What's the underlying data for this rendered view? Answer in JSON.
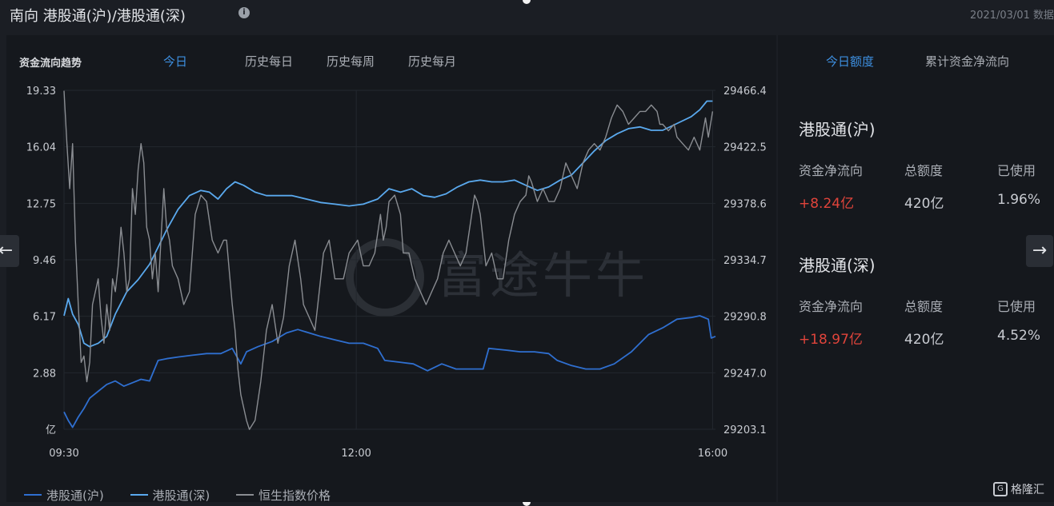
{
  "header": {
    "title": "南向 港股通(沪)/港股通(深)",
    "date": "2021/03/01 数据"
  },
  "chart_tabs": {
    "label": "资金流向趋势",
    "items": [
      "今日",
      "历史每日",
      "历史每周",
      "历史每月"
    ],
    "active": "今日"
  },
  "right_tabs": {
    "items": [
      "今日额度",
      "累计资金净流向"
    ],
    "active": "今日额度"
  },
  "quota": [
    {
      "title": "港股通(沪)",
      "headers": [
        "资金净流向",
        "总额度",
        "已使用"
      ],
      "values": [
        "+8.24亿",
        "420亿",
        "1.96%"
      ]
    },
    {
      "title": "港股通(深)",
      "headers": [
        "资金净流向",
        "总额度",
        "已使用"
      ],
      "values": [
        "+18.97亿",
        "420亿",
        "4.52%"
      ]
    }
  ],
  "watermark": "富途牛牛",
  "brand": "格隆汇",
  "colors": {
    "sh": "#2f6fd0",
    "sz": "#5aa9ee",
    "index": "#8a8d92",
    "red": "#e0443b",
    "active": "#3d8fe0"
  },
  "chart_data": {
    "type": "line",
    "y_left_ticks": [
      "19.33",
      "16.04",
      "12.75",
      "9.46",
      "6.17",
      "2.88",
      "亿"
    ],
    "y_right_ticks": [
      "29466.4",
      "29422.5",
      "29378.6",
      "29334.7",
      "29290.8",
      "29247.0",
      "29203.1"
    ],
    "x_ticks": [
      "09:30",
      "12:00",
      "16:00"
    ],
    "y_left_range": [
      -0.41,
      19.33
    ],
    "y_right_range": [
      29203.1,
      29466.4
    ],
    "series": [
      {
        "name": "港股通(沪)",
        "axis": "left",
        "color": "#2f6fd0",
        "points": [
          [
            0,
            0.6
          ],
          [
            3,
            0.1
          ],
          [
            6,
            -0.3
          ],
          [
            10,
            0.3
          ],
          [
            14,
            0.8
          ],
          [
            18,
            1.4
          ],
          [
            24,
            1.8
          ],
          [
            30,
            2.2
          ],
          [
            36,
            2.4
          ],
          [
            42,
            2.1
          ],
          [
            48,
            2.3
          ],
          [
            54,
            2.5
          ],
          [
            60,
            2.4
          ],
          [
            66,
            3.6
          ],
          [
            72,
            3.7
          ],
          [
            80,
            3.8
          ],
          [
            90,
            3.9
          ],
          [
            100,
            4.0
          ],
          [
            110,
            4.0
          ],
          [
            118,
            4.3
          ],
          [
            124,
            3.4
          ],
          [
            128,
            4.1
          ],
          [
            136,
            4.4
          ],
          [
            146,
            4.7
          ],
          [
            156,
            5.2
          ],
          [
            164,
            5.4
          ],
          [
            172,
            5.2
          ],
          [
            180,
            5.0
          ],
          [
            190,
            4.8
          ],
          [
            200,
            4.6
          ],
          [
            210,
            4.6
          ],
          [
            220,
            4.3
          ],
          [
            225,
            3.6
          ],
          [
            235,
            3.5
          ],
          [
            245,
            3.4
          ],
          [
            255,
            3.0
          ],
          [
            265,
            3.4
          ],
          [
            275,
            3.1
          ],
          [
            285,
            3.1
          ],
          [
            294,
            3.1
          ],
          [
            298,
            4.3
          ],
          [
            310,
            4.2
          ],
          [
            320,
            4.1
          ],
          [
            330,
            4.1
          ],
          [
            340,
            4.0
          ],
          [
            346,
            3.6
          ],
          [
            356,
            3.3
          ],
          [
            366,
            3.1
          ],
          [
            376,
            3.1
          ],
          [
            386,
            3.4
          ],
          [
            398,
            4.1
          ],
          [
            410,
            5.1
          ],
          [
            420,
            5.5
          ],
          [
            430,
            6.0
          ],
          [
            440,
            6.1
          ],
          [
            446,
            6.2
          ],
          [
            452,
            6.0
          ],
          [
            454,
            4.9
          ],
          [
            457,
            5.0
          ]
        ]
      },
      {
        "name": "港股通(深)",
        "axis": "left",
        "color": "#5aa9ee",
        "points": [
          [
            0,
            6.2
          ],
          [
            3,
            7.2
          ],
          [
            6,
            6.3
          ],
          [
            10,
            5.7
          ],
          [
            14,
            4.6
          ],
          [
            18,
            4.4
          ],
          [
            24,
            4.6
          ],
          [
            30,
            5.0
          ],
          [
            36,
            6.3
          ],
          [
            44,
            7.6
          ],
          [
            52,
            8.3
          ],
          [
            60,
            9.2
          ],
          [
            66,
            10.2
          ],
          [
            72,
            11.2
          ],
          [
            80,
            12.4
          ],
          [
            88,
            13.2
          ],
          [
            96,
            13.5
          ],
          [
            102,
            13.4
          ],
          [
            108,
            13.0
          ],
          [
            114,
            13.6
          ],
          [
            120,
            14.0
          ],
          [
            126,
            13.8
          ],
          [
            134,
            13.4
          ],
          [
            142,
            13.2
          ],
          [
            150,
            13.2
          ],
          [
            160,
            13.2
          ],
          [
            170,
            13.0
          ],
          [
            180,
            12.8
          ],
          [
            190,
            12.7
          ],
          [
            200,
            12.6
          ],
          [
            210,
            12.7
          ],
          [
            220,
            13.0
          ],
          [
            228,
            13.6
          ],
          [
            236,
            13.4
          ],
          [
            244,
            13.6
          ],
          [
            252,
            13.2
          ],
          [
            260,
            13.1
          ],
          [
            268,
            13.3
          ],
          [
            276,
            13.7
          ],
          [
            284,
            14.0
          ],
          [
            292,
            14.1
          ],
          [
            300,
            14.0
          ],
          [
            308,
            14.0
          ],
          [
            316,
            14.1
          ],
          [
            324,
            13.8
          ],
          [
            332,
            13.5
          ],
          [
            340,
            13.7
          ],
          [
            348,
            14.1
          ],
          [
            356,
            14.4
          ],
          [
            364,
            15.1
          ],
          [
            372,
            15.8
          ],
          [
            380,
            16.4
          ],
          [
            388,
            16.8
          ],
          [
            396,
            17.1
          ],
          [
            404,
            17.2
          ],
          [
            412,
            17.0
          ],
          [
            420,
            17.0
          ],
          [
            430,
            17.4
          ],
          [
            440,
            17.8
          ],
          [
            446,
            18.2
          ],
          [
            451,
            18.7
          ],
          [
            455,
            18.7
          ]
        ]
      },
      {
        "name": "恒生指数价格",
        "axis": "right",
        "color": "#8a8d92",
        "points": [
          [
            0,
            29466
          ],
          [
            2,
            29425
          ],
          [
            4,
            29390
          ],
          [
            6,
            29425
          ],
          [
            8,
            29350
          ],
          [
            10,
            29300
          ],
          [
            12,
            29255
          ],
          [
            14,
            29260
          ],
          [
            16,
            29240
          ],
          [
            18,
            29255
          ],
          [
            20,
            29300
          ],
          [
            24,
            29320
          ],
          [
            26,
            29290
          ],
          [
            28,
            29270
          ],
          [
            30,
            29300
          ],
          [
            32,
            29280
          ],
          [
            34,
            29320
          ],
          [
            36,
            29310
          ],
          [
            38,
            29330
          ],
          [
            40,
            29360
          ],
          [
            42,
            29340
          ],
          [
            44,
            29310
          ],
          [
            46,
            29320
          ],
          [
            48,
            29390
          ],
          [
            50,
            29370
          ],
          [
            52,
            29405
          ],
          [
            54,
            29425
          ],
          [
            56,
            29410
          ],
          [
            58,
            29360
          ],
          [
            60,
            29350
          ],
          [
            62,
            29320
          ],
          [
            64,
            29340
          ],
          [
            66,
            29310
          ],
          [
            68,
            29350
          ],
          [
            70,
            29390
          ],
          [
            72,
            29360
          ],
          [
            74,
            29350
          ],
          [
            76,
            29330
          ],
          [
            80,
            29320
          ],
          [
            84,
            29300
          ],
          [
            88,
            29310
          ],
          [
            92,
            29370
          ],
          [
            96,
            29385
          ],
          [
            100,
            29380
          ],
          [
            104,
            29350
          ],
          [
            108,
            29340
          ],
          [
            112,
            29350
          ],
          [
            114,
            29350
          ],
          [
            118,
            29300
          ],
          [
            120,
            29280
          ],
          [
            122,
            29250
          ],
          [
            124,
            29230
          ],
          [
            128,
            29210
          ],
          [
            130,
            29203
          ],
          [
            134,
            29210
          ],
          [
            138,
            29240
          ],
          [
            142,
            29280
          ],
          [
            146,
            29300
          ],
          [
            150,
            29270
          ],
          [
            154,
            29290
          ],
          [
            158,
            29330
          ],
          [
            162,
            29350
          ],
          [
            164,
            29335
          ],
          [
            166,
            29320
          ],
          [
            168,
            29300
          ],
          [
            172,
            29290
          ],
          [
            176,
            29280
          ],
          [
            178,
            29300
          ],
          [
            182,
            29340
          ],
          [
            186,
            29350
          ],
          [
            190,
            29320
          ],
          [
            196,
            29320
          ],
          [
            200,
            29340
          ],
          [
            206,
            29350
          ],
          [
            210,
            29330
          ],
          [
            214,
            29330
          ],
          [
            218,
            29340
          ],
          [
            222,
            29370
          ],
          [
            224,
            29350
          ],
          [
            226,
            29360
          ],
          [
            228,
            29380
          ],
          [
            232,
            29385
          ],
          [
            236,
            29370
          ],
          [
            238,
            29340
          ],
          [
            242,
            29340
          ],
          [
            246,
            29320
          ],
          [
            250,
            29310
          ],
          [
            254,
            29300
          ],
          [
            258,
            29310
          ],
          [
            262,
            29320
          ],
          [
            266,
            29340
          ],
          [
            270,
            29350
          ],
          [
            274,
            29340
          ],
          [
            278,
            29330
          ],
          [
            282,
            29340
          ],
          [
            286,
            29370
          ],
          [
            288,
            29385
          ],
          [
            290,
            29380
          ],
          [
            292,
            29370
          ],
          [
            296,
            29330
          ],
          [
            300,
            29340
          ],
          [
            304,
            29320
          ],
          [
            308,
            29320
          ],
          [
            312,
            29350
          ],
          [
            316,
            29370
          ],
          [
            320,
            29380
          ],
          [
            324,
            29385
          ],
          [
            326,
            29400
          ],
          [
            328,
            29395
          ],
          [
            332,
            29380
          ],
          [
            336,
            29390
          ],
          [
            340,
            29380
          ],
          [
            344,
            29380
          ],
          [
            348,
            29390
          ],
          [
            352,
            29410
          ],
          [
            356,
            29400
          ],
          [
            360,
            29390
          ],
          [
            364,
            29410
          ],
          [
            368,
            29420
          ],
          [
            372,
            29425
          ],
          [
            376,
            29420
          ],
          [
            380,
            29430
          ],
          [
            384,
            29445
          ],
          [
            388,
            29455
          ],
          [
            392,
            29450
          ],
          [
            396,
            29440
          ],
          [
            400,
            29445
          ],
          [
            404,
            29450
          ],
          [
            408,
            29450
          ],
          [
            412,
            29455
          ],
          [
            416,
            29450
          ],
          [
            418,
            29440
          ],
          [
            420,
            29440
          ],
          [
            424,
            29435
          ],
          [
            428,
            29440
          ],
          [
            430,
            29430
          ],
          [
            434,
            29425
          ],
          [
            438,
            29420
          ],
          [
            442,
            29430
          ],
          [
            446,
            29420
          ],
          [
            450,
            29445
          ],
          [
            452,
            29430
          ],
          [
            455,
            29450
          ]
        ]
      }
    ],
    "legend_position": "bottom-left",
    "grid": true
  }
}
